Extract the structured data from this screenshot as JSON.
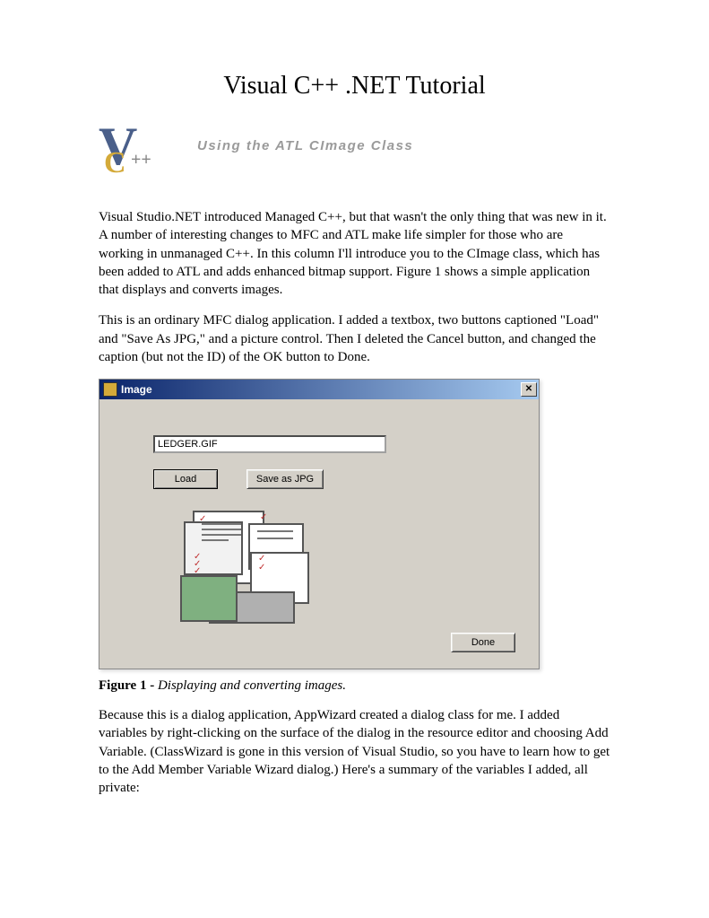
{
  "title": "Visual C++ .NET Tutorial",
  "subtitle": "Using the ATL CImage Class",
  "paragraphs": {
    "p1": "Visual Studio.NET introduced Managed C++, but that wasn't the only thing that was new in it. A number of interesting changes to MFC and ATL make life simpler for those who are working in unmanaged C++. In this column I'll introduce you to the CImage class, which has been added to ATL and adds enhanced bitmap support. Figure 1 shows a simple application that displays and converts images.",
    "p2": "This is an ordinary MFC dialog application. I added a textbox, two buttons captioned \"Load\" and \"Save As JPG,\" and a picture control. Then I deleted the Cancel button, and changed the caption (but not the ID) of the OK button to Done.",
    "p3": "Because this is a dialog application, AppWizard created a dialog class for me. I added variables by right-clicking on the surface of the dialog in the resource editor and choosing Add Variable. (ClassWizard is gone in this version of Visual Studio, so you have to learn how to get to the Add Member Variable Wizard dialog.) Here's a summary of the variables I added, all private:"
  },
  "dialog": {
    "title": "Image",
    "filename": "LEDGER.GIF",
    "buttons": {
      "load": "Load",
      "save": "Save as JPG",
      "done": "Done"
    }
  },
  "figure": {
    "label": "Figure 1 -",
    "caption": "Displaying and converting images."
  }
}
